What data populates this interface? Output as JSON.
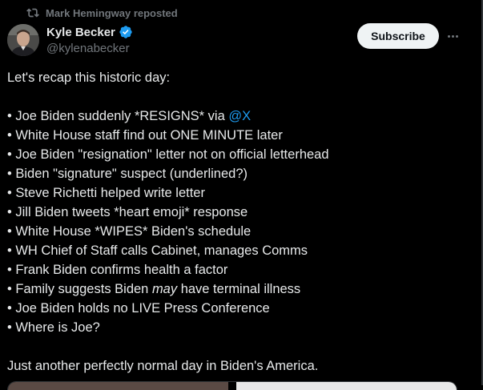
{
  "repost": {
    "text": "Mark Hemingway reposted",
    "icon": "repost-icon"
  },
  "author": {
    "display_name": "Kyle Becker",
    "handle": "@kylenabecker",
    "verified_color": "#1d9bf0"
  },
  "actions": {
    "subscribe_label": "Subscribe",
    "more_icon": "more-icon"
  },
  "tweet": {
    "intro": "Let's recap this historic day:",
    "bullet_1_text": "• Joe Biden suddenly *RESIGNS* via ",
    "bullet_1_mention": "@X",
    "bullet_2": "• White House staff find out ONE MINUTE later",
    "bullet_3": "• Joe Biden \"resignation\" letter not on official letterhead",
    "bullet_4": "• Biden \"signature\" suspect (underlined?)",
    "bullet_5": "• Steve Richetti helped write letter",
    "bullet_6": "• Jill Biden tweets *heart emoji* response",
    "bullet_7": "• White House *WIPES* Biden's schedule",
    "bullet_8": "• WH Chief of Staff calls Cabinet, manages Comms",
    "bullet_9": "• Frank Biden confirms health a factor",
    "bullet_10_pre": "• Family suggests Biden ",
    "bullet_10_italic": "may",
    "bullet_10_post": " have terminal illness",
    "bullet_11": "• Joe Biden holds no LIVE Press Conference",
    "bullet_12": "• Where is Joe?",
    "outro": "Just another perfectly normal day in Biden's America."
  },
  "colors": {
    "background": "#000000",
    "text": "#e7e9ea",
    "muted": "#71767b",
    "link": "#1d9bf0"
  }
}
